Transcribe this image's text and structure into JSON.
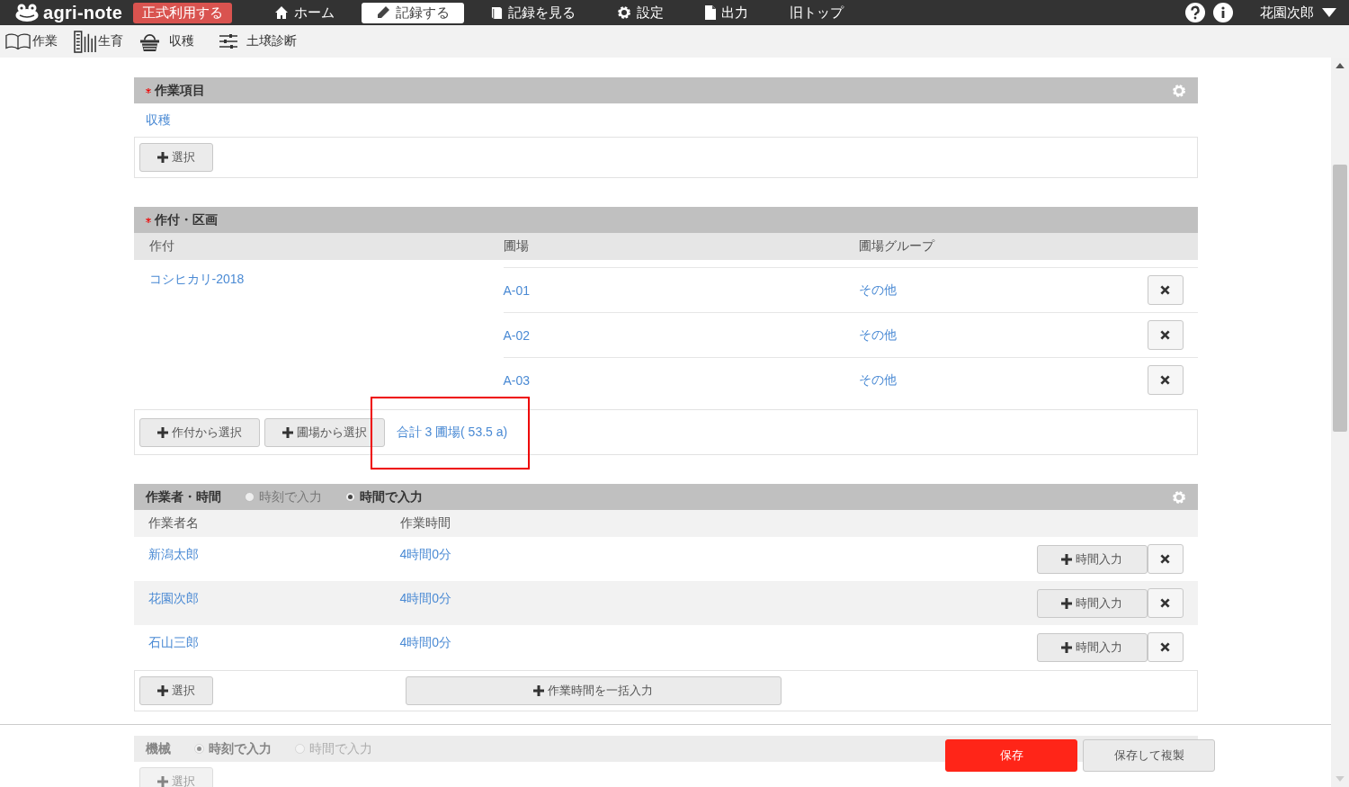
{
  "app": {
    "logo": "agri-note",
    "badge": "正式利用する",
    "user": "花園次郎",
    "nav": [
      {
        "label": "ホーム",
        "selected": false
      },
      {
        "label": "記録する",
        "selected": true
      },
      {
        "label": "記録を見る",
        "selected": false
      },
      {
        "label": "設定",
        "selected": false
      },
      {
        "label": "出力",
        "selected": false
      },
      {
        "label": "旧トップ",
        "selected": false
      }
    ]
  },
  "sub_nav": [
    {
      "label": "作業"
    },
    {
      "label": "生育"
    },
    {
      "label": "収穫"
    },
    {
      "label": "土壌診断"
    }
  ],
  "work_item": {
    "title": "作業項目",
    "required": true,
    "value": "収穫",
    "select_button": "選択"
  },
  "crop_section": {
    "title": "作付・区画",
    "required": true,
    "columns": [
      "作付",
      "圃場",
      "圃場グループ"
    ],
    "crops": [
      {
        "name": "コシヒカリ-2018",
        "plots": [
          {
            "field": "A-01",
            "group": "その他"
          },
          {
            "field": "A-02",
            "group": "その他"
          },
          {
            "field": "A-03",
            "group": "その他"
          }
        ]
      }
    ],
    "buttons": [
      "作付から選択",
      "圃場から選択"
    ],
    "total": "合計 3 圃場( 53.5 a)",
    "total_highlighted": true
  },
  "worker_section": {
    "title": "作業者・時間",
    "required": false,
    "modes": [
      {
        "label": "時刻で入力",
        "selected": false
      },
      {
        "label": "時間で入力",
        "selected": true
      }
    ],
    "columns": [
      "作業者名",
      "作業時間"
    ],
    "workers": [
      {
        "name": "新潟太郎",
        "time": "4時間0分",
        "button": "時間入力"
      },
      {
        "name": "花園次郎",
        "time": "4時間0分",
        "button": "時間入力"
      },
      {
        "name": "石山三郎",
        "time": "4時間0分",
        "button": "時間入力"
      }
    ],
    "select_button": "選択",
    "bulk_button": "作業時間を一括入力"
  },
  "machine_section": {
    "title": "機械",
    "modes": [
      {
        "label": "時刻で入力",
        "selected": true
      },
      {
        "label": "時間で入力",
        "selected": false
      }
    ],
    "select_button": "選択"
  },
  "footer": {
    "save": "保存",
    "save_copy": "保存して複製"
  }
}
